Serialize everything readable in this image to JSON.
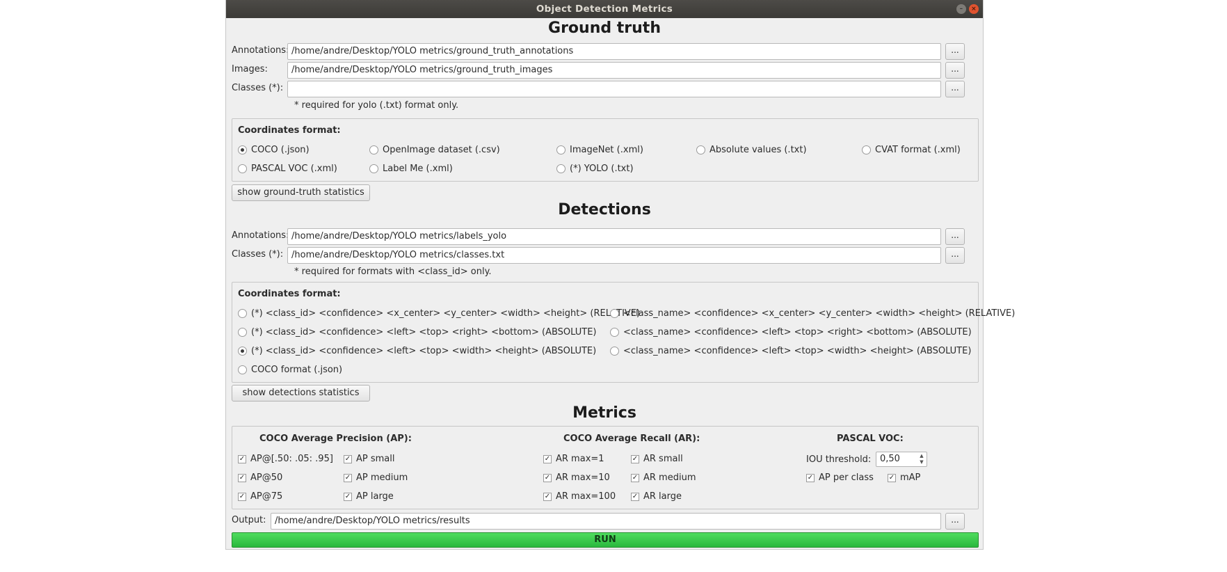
{
  "window": {
    "title": "Object Detection Metrics"
  },
  "ground_truth": {
    "title": "Ground truth",
    "annotations_label": "Annotations:",
    "annotations_value": "/home/andre/Desktop/YOLO metrics/ground_truth_annotations",
    "images_label": "Images:",
    "images_value": "/home/andre/Desktop/YOLO metrics/ground_truth_images",
    "classes_label": "Classes (*):",
    "classes_value": "",
    "browse_label": "...",
    "note": "* required for yolo (.txt) format only.",
    "format_title": "Coordinates format:",
    "formats": [
      {
        "label": "COCO (.json)",
        "selected": true
      },
      {
        "label": "OpenImage dataset (.csv)",
        "selected": false
      },
      {
        "label": "ImageNet (.xml)",
        "selected": false
      },
      {
        "label": "Absolute values (.txt)",
        "selected": false
      },
      {
        "label": "CVAT format (.xml)",
        "selected": false
      },
      {
        "label": "PASCAL VOC (.xml)",
        "selected": false
      },
      {
        "label": "Label Me (.xml)",
        "selected": false
      },
      {
        "label": "(*) YOLO (.txt)",
        "selected": false
      }
    ],
    "stats_button": "show ground-truth statistics"
  },
  "detections": {
    "title": "Detections",
    "annotations_label": "Annotations:",
    "annotations_value": "/home/andre/Desktop/YOLO metrics/labels_yolo",
    "classes_label": "Classes (*):",
    "classes_value": "/home/andre/Desktop/YOLO metrics/classes.txt",
    "browse_label": "...",
    "note": "* required for formats with <class_id> only.",
    "format_title": "Coordinates format:",
    "formats": [
      {
        "label": "(*) <class_id> <confidence> <x_center> <y_center> <width> <height> (RELATIVE)",
        "selected": false
      },
      {
        "label": "<class_name> <confidence> <x_center> <y_center> <width> <height> (RELATIVE)",
        "selected": false
      },
      {
        "label": "(*) <class_id> <confidence> <left> <top> <right> <bottom> (ABSOLUTE)",
        "selected": false
      },
      {
        "label": "<class_name> <confidence> <left> <top> <right> <bottom> (ABSOLUTE)",
        "selected": false
      },
      {
        "label": "(*) <class_id> <confidence> <left> <top> <width> <height> (ABSOLUTE)",
        "selected": true
      },
      {
        "label": "<class_name> <confidence> <left> <top> <width> <height> (ABSOLUTE)",
        "selected": false
      },
      {
        "label": "COCO format (.json)",
        "selected": false
      }
    ],
    "stats_button": "show detections statistics"
  },
  "metrics": {
    "title": "Metrics",
    "ap_header": "COCO Average Precision (AP):",
    "ar_header": "COCO Average Recall (AR):",
    "voc_header": "PASCAL VOC:",
    "ap_items": [
      {
        "label": "AP@[.50: .05: .95]",
        "checked": true
      },
      {
        "label": "AP small",
        "checked": true
      },
      {
        "label": "AP@50",
        "checked": true
      },
      {
        "label": "AP medium",
        "checked": true
      },
      {
        "label": "AP@75",
        "checked": true
      },
      {
        "label": "AP large",
        "checked": true
      }
    ],
    "ar_items": [
      {
        "label": "AR max=1",
        "checked": true
      },
      {
        "label": "AR small",
        "checked": true
      },
      {
        "label": "AR max=10",
        "checked": true
      },
      {
        "label": "AR medium",
        "checked": true
      },
      {
        "label": "AR max=100",
        "checked": true
      },
      {
        "label": "AR large",
        "checked": true
      }
    ],
    "iou_label": "IOU threshold:",
    "iou_value": "0,50",
    "voc_items": [
      {
        "label": "AP per class",
        "checked": true
      },
      {
        "label": "mAP",
        "checked": true
      }
    ]
  },
  "output": {
    "label": "Output:",
    "value": "/home/andre/Desktop/YOLO metrics/results",
    "browse_label": "..."
  },
  "run_button": "RUN"
}
